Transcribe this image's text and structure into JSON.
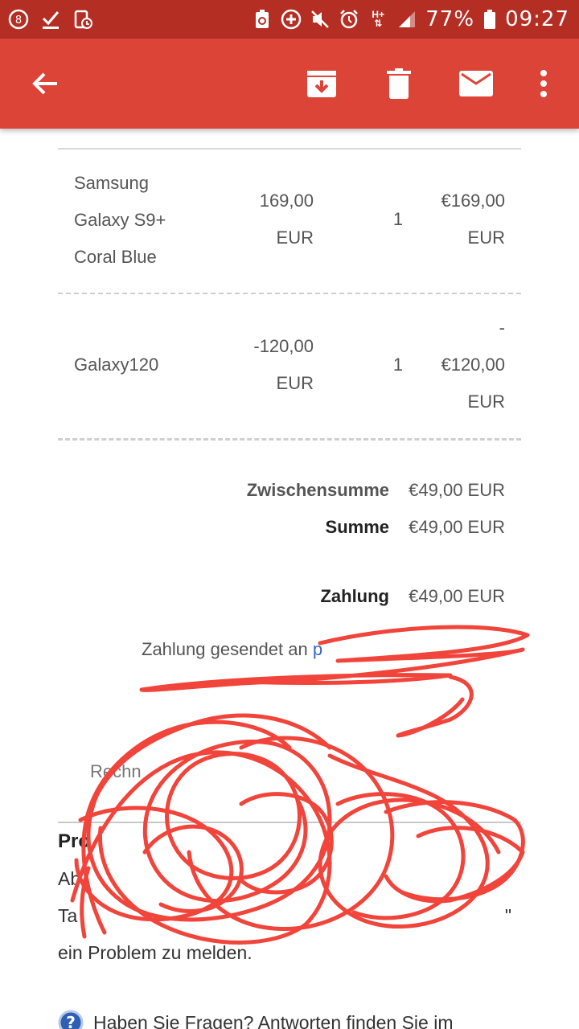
{
  "status_bar": {
    "battery_percent": "77%",
    "time": "09:27",
    "icons": [
      "notification-badge-icon",
      "checkmark-icon",
      "download-icon",
      "recycle-battery-icon",
      "add-circle-icon",
      "mute-icon",
      "alarm-icon",
      "hplus-network-icon",
      "signal-icon",
      "battery-icon"
    ],
    "notification_badge": "8",
    "network_label": "H+"
  },
  "app_bar": {
    "icons": [
      "back-arrow-icon",
      "archive-icon",
      "delete-icon",
      "mark-unread-icon",
      "more-vert-icon"
    ]
  },
  "items": [
    {
      "name_lines": [
        "Samsung",
        "Galaxy S9+",
        "Coral Blue"
      ],
      "unit_price_lines": [
        "169,00",
        "EUR"
      ],
      "quantity": "1",
      "amount_lines": [
        "€169,00",
        "EUR"
      ]
    },
    {
      "name_lines": [
        "Galaxy120"
      ],
      "unit_price_lines": [
        "-120,00",
        "EUR"
      ],
      "quantity": "1",
      "amount_lines": [
        "-",
        "€120,00",
        "EUR"
      ]
    }
  ],
  "totals": {
    "subtotal_label": "Zwischensumme",
    "subtotal_value": "€49,00 EUR",
    "total_label": "Summe",
    "total_value": "€49,00 EUR",
    "payment_label": "Zahlung",
    "payment_value": "€49,00 EUR"
  },
  "payment_sent": {
    "text": "Zahlung gesendet an ",
    "link_fragment": "p"
  },
  "invoice_fragment": "Rechn",
  "problem_section": {
    "heading_fragment": "Pro",
    "line1_fragment": "Ab",
    "line2_fragment": "Ta",
    "line2_end": "\"",
    "line3": "ein Problem zu melden."
  },
  "faq": {
    "text": "Haben Sie Fragen? Antworten finden Sie im"
  },
  "colors": {
    "status_bar": "#b52e24",
    "app_bar": "#db4437",
    "scribble": "#f1443a",
    "link": "#3a66c4"
  }
}
